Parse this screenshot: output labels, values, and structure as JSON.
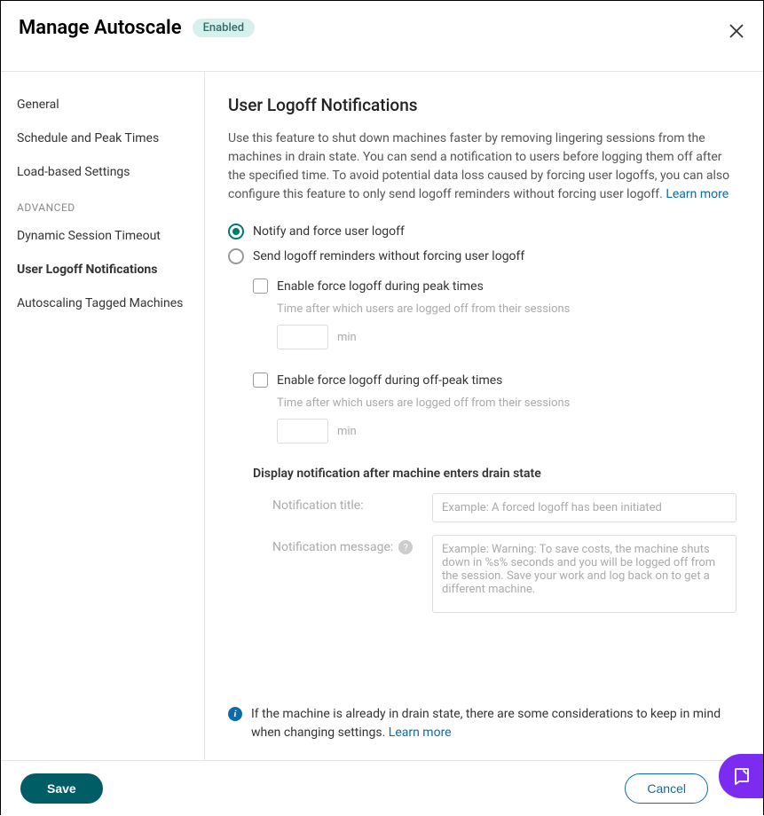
{
  "header": {
    "title": "Manage Autoscale",
    "badge": "Enabled"
  },
  "sidebar": {
    "items": [
      {
        "label": "General"
      },
      {
        "label": "Schedule and Peak Times"
      },
      {
        "label": "Load-based Settings"
      }
    ],
    "advanced_heading": "ADVANCED",
    "advanced_items": [
      {
        "label": "Dynamic Session Timeout"
      },
      {
        "label": "User Logoff Notifications"
      },
      {
        "label": "Autoscaling Tagged Machines"
      }
    ]
  },
  "main": {
    "title": "User Logoff Notifications",
    "description": "Use this feature to shut down machines faster by removing lingering sessions from the machines in drain state. You can send a notification to users before logging them off after the specified time. To avoid potential data loss caused by forcing user logoffs, you can also configure this feature to only send logoff reminders without forcing user logoff. ",
    "learn_more": "Learn more",
    "radio1": "Notify and force user logoff",
    "radio2": "Send logoff reminders without forcing user logoff",
    "checkbox_peak": "Enable force logoff during peak times",
    "peak_help": "Time after which users are logged off from their sessions",
    "min_unit": "min",
    "checkbox_offpeak": "Enable force logoff during off-peak times",
    "offpeak_help": "Time after which users are logged off from their sessions",
    "section_label": "Display notification after machine enters drain state",
    "notif_title_label": "Notification title:",
    "notif_title_placeholder": "Example: A forced logoff has been initiated",
    "notif_msg_label": "Notification message:",
    "notif_msg_placeholder": "Example: Warning: To save costs, the machine shuts down in %s% seconds and you will be logged off from the session. Save your work and log back on to get a different machine.",
    "info_text": "If the machine is already in drain state, there are some considerations to keep in mind when changing settings. ",
    "info_learn_more": "Learn more"
  },
  "footer": {
    "save": "Save",
    "cancel": "Cancel"
  }
}
